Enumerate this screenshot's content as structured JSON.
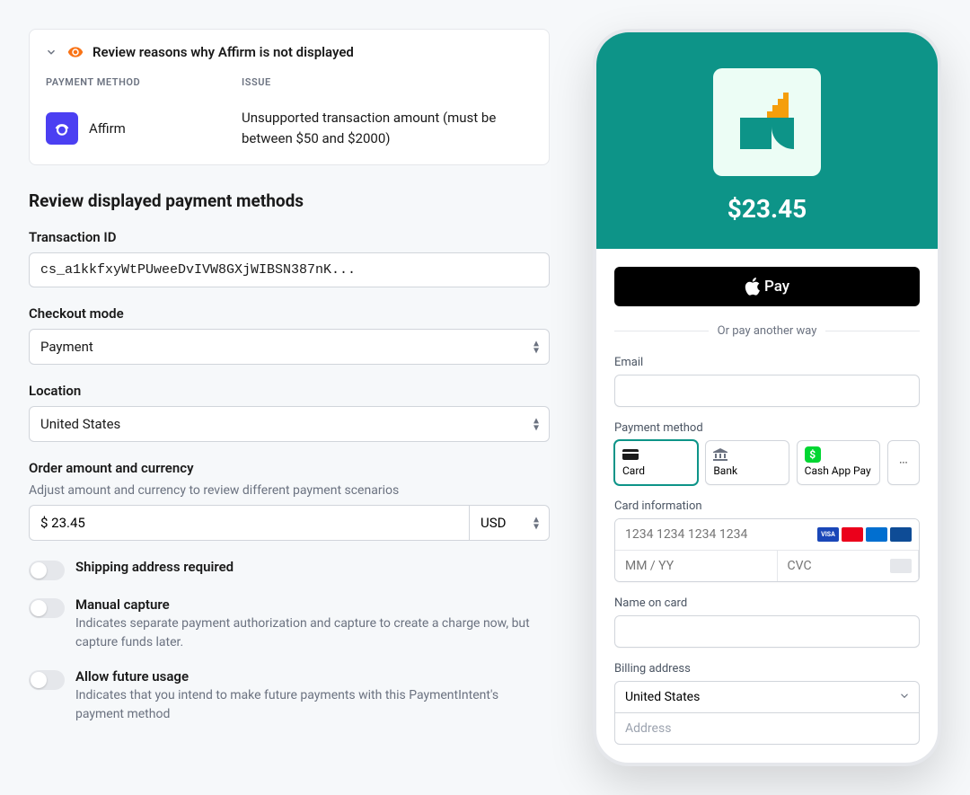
{
  "alert": {
    "title": "Review reasons why Affirm is not displayed",
    "col_pm": "PAYMENT METHOD",
    "col_issue": "ISSUE",
    "pm_name": "Affirm",
    "issue": "Unsupported transaction amount (must be between $50 and $2000)"
  },
  "heading": "Review displayed payment methods",
  "txn": {
    "label": "Transaction ID",
    "value": "cs_a1kkfxyWtPUweeDvIVW8GXjWIBSN387nK..."
  },
  "mode": {
    "label": "Checkout mode",
    "value": "Payment"
  },
  "location": {
    "label": "Location",
    "value": "United States"
  },
  "amount": {
    "label": "Order amount and currency",
    "help": "Adjust amount and currency to review different payment scenarios",
    "value": "$ 23.45",
    "currency": "USD"
  },
  "toggles": {
    "shipping": {
      "label": "Shipping address required"
    },
    "capture": {
      "label": "Manual capture",
      "desc": "Indicates separate payment authorization and capture to create a charge now, but capture funds later."
    },
    "future": {
      "label": "Allow future usage",
      "desc": "Indicates that you intend to make future payments with this PaymentIntent's payment method"
    }
  },
  "phone": {
    "price": "$23.45",
    "apple_pay": "Pay",
    "divider": "Or pay another way",
    "email_label": "Email",
    "pm_label": "Payment method",
    "pm_card": "Card",
    "pm_bank": "Bank",
    "pm_cash": "Cash App Pay",
    "pm_more": "···",
    "card_info_label": "Card information",
    "card_placeholder": "1234 1234 1234 1234",
    "exp_placeholder": "MM / YY",
    "cvc_placeholder": "CVC",
    "name_label": "Name on card",
    "billing_label": "Billing address",
    "country": "United States",
    "address_placeholder": "Address"
  }
}
